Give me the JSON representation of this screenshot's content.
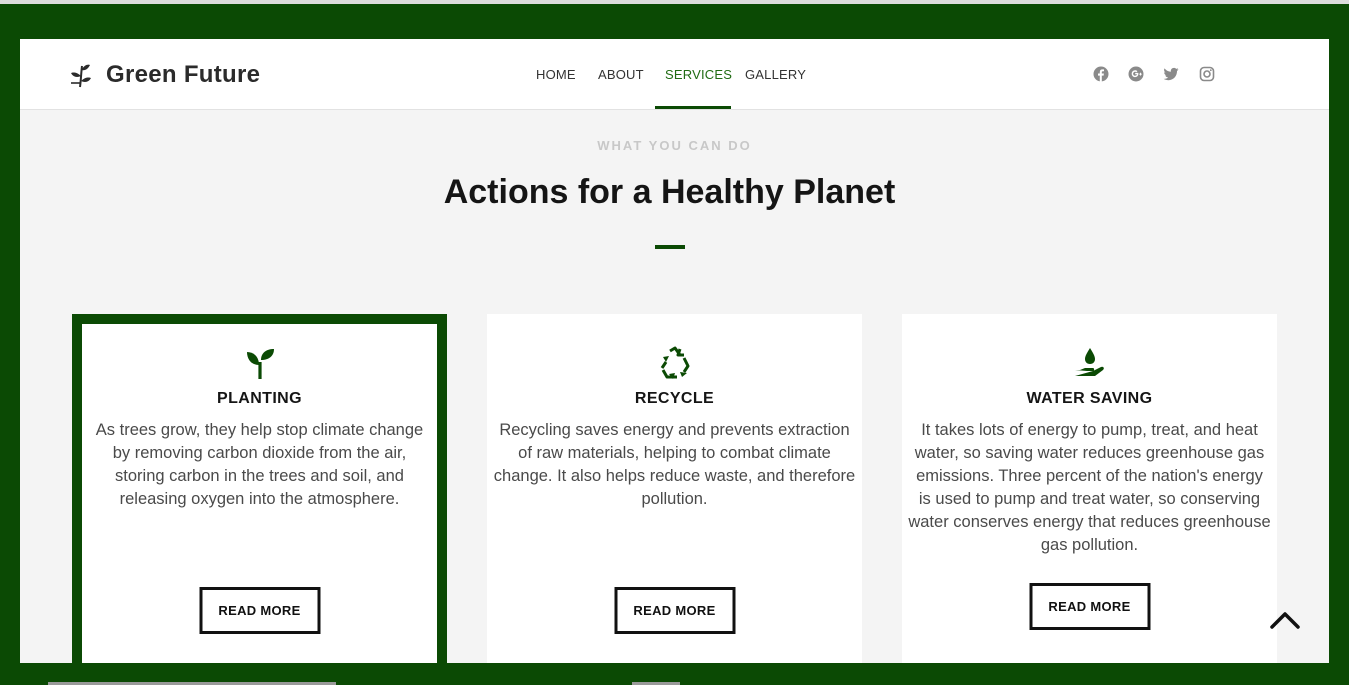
{
  "brand": {
    "name": "Green Future",
    "icon": "leaf-sprig-icon"
  },
  "nav": {
    "items": [
      {
        "label": "HOME",
        "active": false
      },
      {
        "label": "ABOUT",
        "active": false
      },
      {
        "label": "SERVICES",
        "active": true
      },
      {
        "label": "GALLERY",
        "active": false
      }
    ]
  },
  "social": [
    "facebook-icon",
    "google-plus-icon",
    "twitter-icon",
    "instagram-icon"
  ],
  "section": {
    "kicker": "WHAT YOU CAN DO",
    "title": "Actions for a Healthy Planet"
  },
  "cards": [
    {
      "icon": "seedling-icon",
      "title": "PLANTING",
      "text": "As trees grow, they help stop climate change by removing carbon dioxide from the air, storing carbon in the trees and soil, and releasing oxygen into the atmosphere.",
      "button": "READ MORE",
      "highlighted": true
    },
    {
      "icon": "recycle-icon",
      "title": "RECYCLE",
      "text": "Recycling saves energy and prevents extraction of raw materials, helping to combat climate change. It also helps reduce waste, and therefore pollution.",
      "button": "READ MORE",
      "highlighted": false
    },
    {
      "icon": "hand-water-drop-icon",
      "title": "WATER SAVING",
      "text": "It takes lots of energy to pump, treat, and heat water, so saving water reduces greenhouse gas emissions. Three percent of the nation's energy is used to pump and treat water, so conserving water conserves energy that reduces greenhouse gas pollution.",
      "button": "READ MORE",
      "highlighted": false
    }
  ],
  "colors": {
    "brand_green": "#0b4a04",
    "active_nav": "#1f6b12",
    "background": "#f4f4f4"
  }
}
